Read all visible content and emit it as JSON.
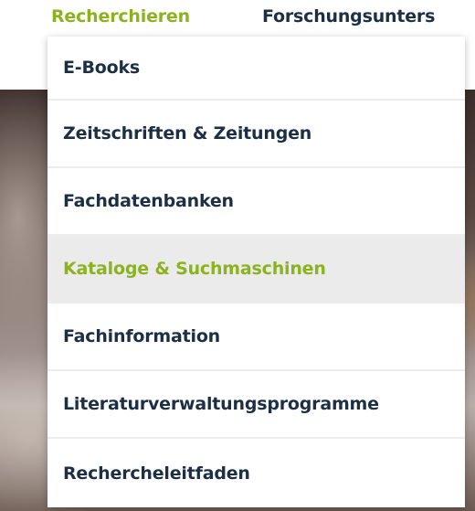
{
  "top_nav": {
    "items": [
      {
        "label": "Recherchieren",
        "active": true
      },
      {
        "label": "Forschungsunters"
      }
    ]
  },
  "dropdown": {
    "items": [
      {
        "label": "E-Books"
      },
      {
        "label": "Zeitschriften & Zeitungen"
      },
      {
        "label": "Fachdatenbanken"
      },
      {
        "label": "Kataloge & Suchmaschinen",
        "hovered": true
      },
      {
        "label": "Fachinformation"
      },
      {
        "label": "Literaturverwaltungsprogramme"
      },
      {
        "label": "Rechercheleitfaden"
      }
    ]
  },
  "colors": {
    "accent": "#8cb21e",
    "text": "#1c2f44",
    "hover_bg": "#ebebeb",
    "divider": "#ececec"
  }
}
